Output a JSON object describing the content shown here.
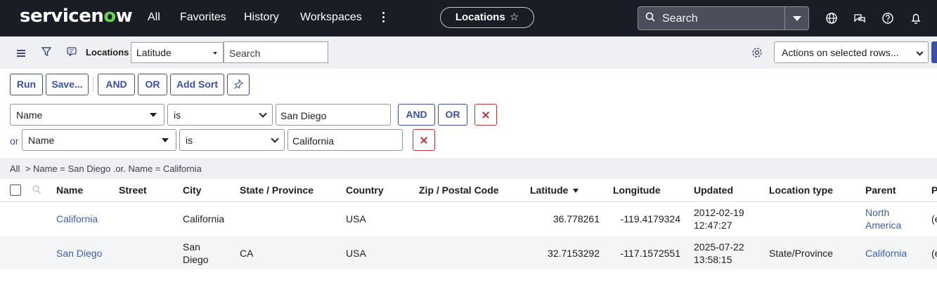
{
  "header": {
    "brand": "servicenow",
    "nav": [
      "All",
      "Favorites",
      "History",
      "Workspaces"
    ],
    "context_title": "Locations",
    "search_placeholder": "Search"
  },
  "listbar": {
    "title": "Locations",
    "search_field": "Latitude",
    "search_placeholder": "Search",
    "actions": "Actions on selected rows..."
  },
  "filter": {
    "buttons": {
      "run": "Run",
      "save": "Save...",
      "and": "AND",
      "or": "OR",
      "add_sort": "Add Sort"
    },
    "conditions": [
      {
        "field": "Name",
        "operator": "is",
        "value": "San Diego"
      },
      {
        "prefix": "or",
        "field": "Name",
        "operator": "is",
        "value": "California"
      }
    ],
    "and_label": "AND",
    "or_label": "OR"
  },
  "breadcrumb": {
    "all": "All",
    "separator": ">",
    "condition": "Name = San Diego .or. Name = California"
  },
  "table": {
    "columns": [
      "Name",
      "Street",
      "City",
      "State / Province",
      "Country",
      "Zip / Postal Code",
      "Latitude",
      "Longitude",
      "Updated",
      "Location type",
      "Parent",
      "P"
    ],
    "rows": [
      {
        "name": "California",
        "street": "",
        "city": "California",
        "state": "",
        "country": "USA",
        "zip": "",
        "latitude": "36.778261",
        "longitude": "-119.4179324",
        "updated_date": "2012-02-19",
        "updated_time": "12:47:27",
        "location_type": "",
        "parent_line1": "North",
        "parent_line2": "America",
        "extra": "(e"
      },
      {
        "name": "San Diego",
        "street": "",
        "city_line1": "San",
        "city_line2": "Diego",
        "state": "CA",
        "country": "USA",
        "zip": "",
        "latitude": "32.7153292",
        "longitude": "-117.1572551",
        "updated_date": "2025-07-22",
        "updated_time": "13:58:15",
        "location_type": "State/Province",
        "parent": "California",
        "extra": "(e"
      }
    ]
  },
  "colors": {
    "topbar": "#1a1d26",
    "accent": "#3c4fa8",
    "brand_o": "#62d84e",
    "remove": "#c0313a"
  }
}
